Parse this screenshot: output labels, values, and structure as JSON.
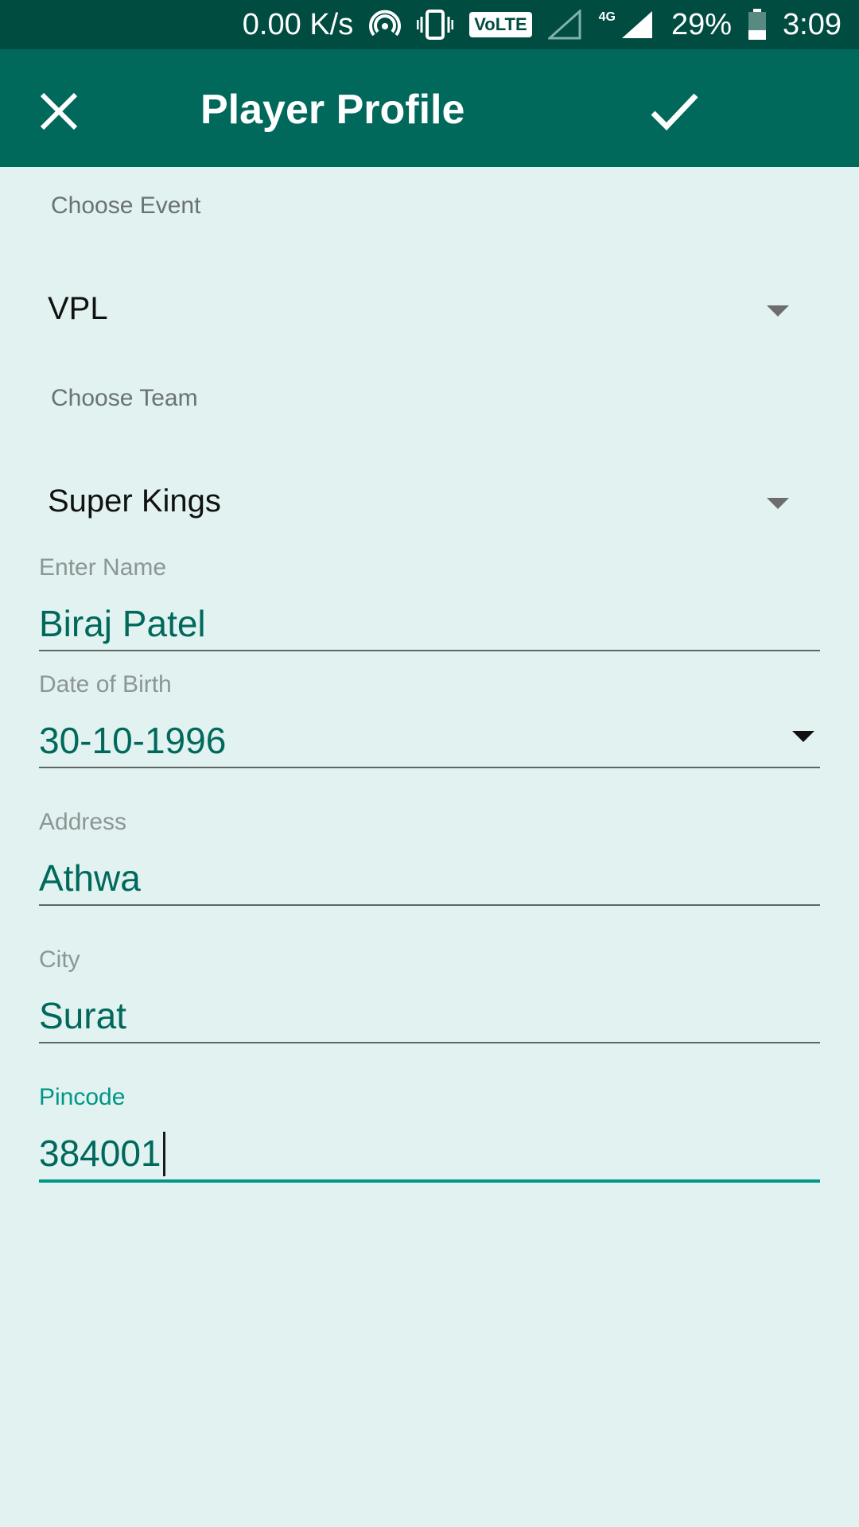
{
  "status_bar": {
    "net_speed": "0.00 K/s",
    "volte": "VoLTE",
    "network_type": "4G",
    "battery": "29%",
    "time": "3:09"
  },
  "app_bar": {
    "title": "Player Profile",
    "close_icon": "close-icon",
    "confirm_icon": "check-icon"
  },
  "form": {
    "event": {
      "label": "Choose Event",
      "value": "VPL"
    },
    "team": {
      "label": "Choose Team",
      "value": "Super Kings"
    },
    "name": {
      "label": "Enter Name",
      "value": "Biraj Patel"
    },
    "dob": {
      "label": "Date of Birth",
      "value": "30-10-1996"
    },
    "address": {
      "label": "Address",
      "value": "Athwa"
    },
    "city": {
      "label": "City",
      "value": "Surat"
    },
    "pincode": {
      "label": "Pincode",
      "value": "384001"
    }
  },
  "colors": {
    "status_bar": "#004c40",
    "app_bar": "#00695c",
    "background": "#e1f2f1",
    "accent": "#009688"
  }
}
